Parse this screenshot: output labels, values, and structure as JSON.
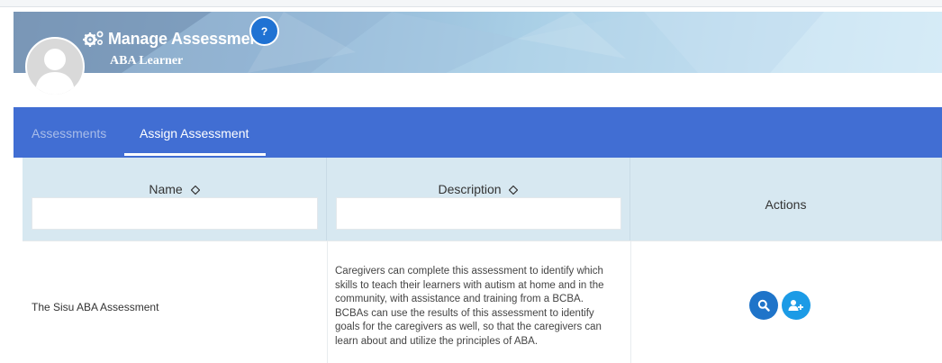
{
  "header": {
    "title": "Manage Assessment",
    "help_label": "?",
    "learner_name": "ABA Learner"
  },
  "tabs": [
    {
      "label": "Assessments",
      "active": false
    },
    {
      "label": "Assign Assessment",
      "active": true
    }
  ],
  "table": {
    "columns": [
      {
        "label": "Name",
        "sortable": true,
        "filter_value": ""
      },
      {
        "label": "Description",
        "sortable": true,
        "filter_value": ""
      },
      {
        "label": "Actions",
        "sortable": false
      }
    ],
    "rows": [
      {
        "name": "The Sisu ABA Assessment",
        "description": "Caregivers can complete this assessment to identify which skills to teach their learners with autism at home and in the community, with assistance and training from a BCBA. BCBAs can use the results of this assessment to identify goals for the caregivers as well, so that the caregivers can learn about and utilize the principles of ABA.",
        "actions": [
          "view-icon",
          "assign-user-icon"
        ]
      }
    ]
  },
  "colors": {
    "tab_bar": "#416ed3",
    "header_cell": "#d7e8f1",
    "view_button": "#1f74c9",
    "assign_button": "#1c9be6",
    "help_badge": "#1f72d3"
  }
}
